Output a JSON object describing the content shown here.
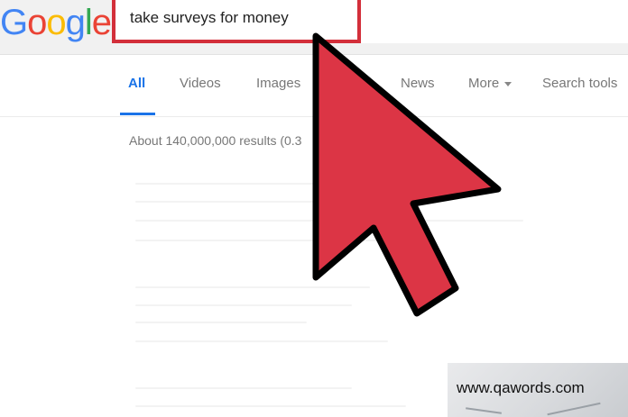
{
  "logo": {
    "letters": [
      {
        "char": "G",
        "color": "#4285F4"
      },
      {
        "char": "o",
        "color": "#EA4335"
      },
      {
        "char": "o",
        "color": "#FBBC05"
      },
      {
        "char": "g",
        "color": "#4285F4"
      },
      {
        "char": "l",
        "color": "#34A853"
      },
      {
        "char": "e",
        "color": "#EA4335"
      }
    ]
  },
  "search": {
    "query": "take surveys for money"
  },
  "tabs": [
    {
      "label": "All",
      "active": true
    },
    {
      "label": "Videos"
    },
    {
      "label": "Images"
    },
    {
      "label": "News"
    },
    {
      "label": "More",
      "dropdown": true
    },
    {
      "label": "Search tools"
    }
  ],
  "results": {
    "stats": "About 140,000,000 results (0.3"
  },
  "overlay": {
    "pointer_color": "#dc3545",
    "pointer_icon": "arrow-cursor-icon"
  },
  "watermark": {
    "text": "www.qawords.com"
  },
  "colors": {
    "accent": "#1a73e8",
    "highlight_border": "#d32f3a"
  }
}
